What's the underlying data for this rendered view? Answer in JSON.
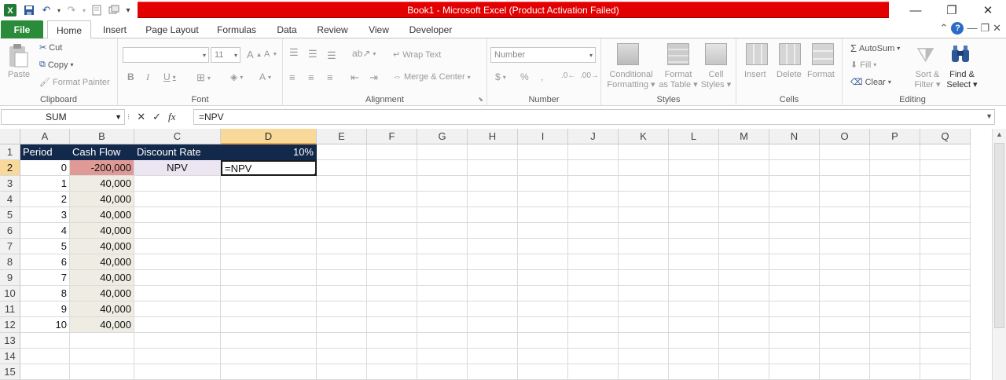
{
  "window": {
    "title": "Book1  -  Microsoft Excel (Product Activation Failed)",
    "minimize": "—",
    "restore": "❐",
    "close": "✕"
  },
  "qat": {
    "save": "💾",
    "undo": "↶",
    "redo": "↷",
    "customize": "▾"
  },
  "tabs": [
    "File",
    "Home",
    "Insert",
    "Page Layout",
    "Formulas",
    "Data",
    "Review",
    "View",
    "Developer"
  ],
  "ribbon": {
    "clipboard": {
      "paste": "Paste",
      "cut": "Cut",
      "copy": "Copy",
      "format_painter": "Format Painter",
      "label": "Clipboard"
    },
    "font": {
      "size": "11",
      "label": "Font"
    },
    "alignment": {
      "wrap_text": "Wrap Text",
      "merge_center": "Merge & Center",
      "label": "Alignment"
    },
    "number": {
      "format": "Number",
      "label": "Number"
    },
    "styles": {
      "conditional": "Conditional",
      "conditional2": "Formatting",
      "format_table": "Format",
      "format_table2": "as Table",
      "cell_styles": "Cell",
      "cell_styles2": "Styles",
      "label": "Styles"
    },
    "cells": {
      "insert": "Insert",
      "delete": "Delete",
      "format": "Format",
      "label": "Cells"
    },
    "editing": {
      "autosum": "AutoSum",
      "fill": "Fill",
      "clear": "Clear",
      "sort": "Sort &",
      "sort2": "Filter",
      "find": "Find &",
      "find2": "Select",
      "label": "Editing"
    }
  },
  "formula_bar": {
    "name_box": "SUM",
    "formula": "=NPV"
  },
  "columns": [
    "A",
    "B",
    "C",
    "D",
    "E",
    "F",
    "G",
    "H",
    "I",
    "J",
    "K",
    "L",
    "M",
    "N",
    "O",
    "P",
    "Q"
  ],
  "rows": [
    "1",
    "2",
    "3",
    "4",
    "5",
    "6",
    "7",
    "8",
    "9",
    "10",
    "11",
    "12",
    "13",
    "14",
    "15"
  ],
  "sheet": {
    "header": {
      "a": "Period",
      "b": "Cash Flow",
      "c": "Discount Rate",
      "d": "10%"
    },
    "npv_label": "NPV",
    "active_cell_text": "=NPV",
    "periods": [
      "0",
      "1",
      "2",
      "3",
      "4",
      "5",
      "6",
      "7",
      "8",
      "9",
      "10"
    ],
    "cash_flows": [
      "-200,000",
      "40,000",
      "40,000",
      "40,000",
      "40,000",
      "40,000",
      "40,000",
      "40,000",
      "40,000",
      "40,000",
      "40,000"
    ]
  }
}
